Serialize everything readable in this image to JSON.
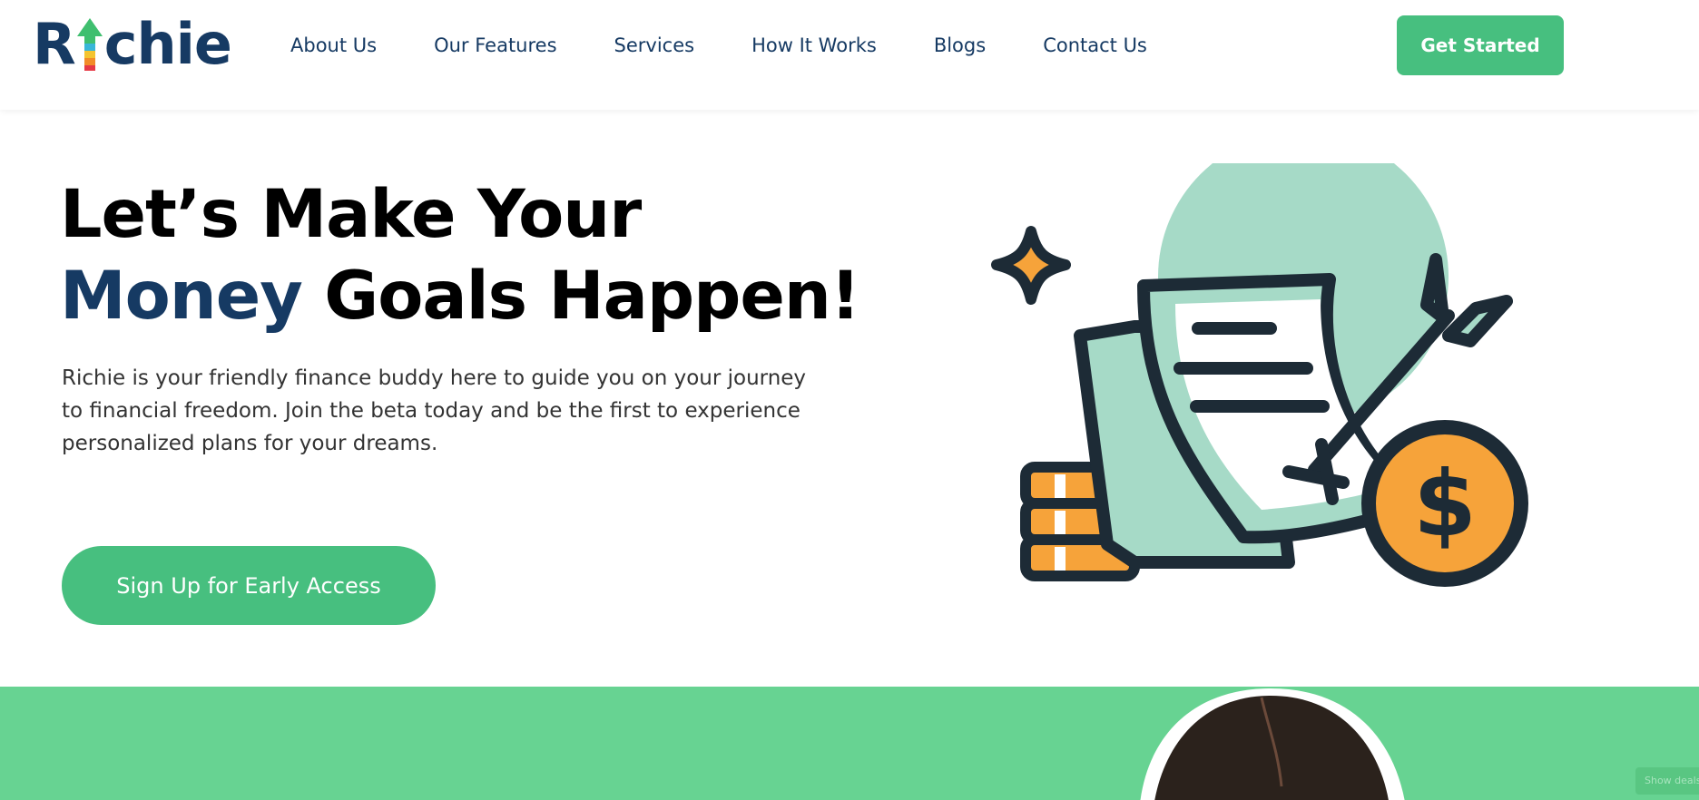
{
  "brand": {
    "logo_text_prefix": "R",
    "logo_text_suffix": "chie",
    "primary_color": "#163a63",
    "accent_color": "#47bf7f"
  },
  "nav": {
    "items": [
      "About Us",
      "Our Features",
      "Services",
      "How It Works",
      "Blogs",
      "Contact Us"
    ],
    "cta_label": "Get Started"
  },
  "hero": {
    "title_line1": "Let’s Make Your",
    "title_accent": "Money",
    "title_line2_rest": "Goals Happen!",
    "description": "Richie is your friendly finance buddy here to guide you on your journey to financial freedom. Join the beta today and be the first to experience personalized plans for your dreams.",
    "signup_label": "Sign Up for Early Access"
  },
  "footer_badge": {
    "label": "Show deals"
  },
  "icons": {
    "illustration": "finance-goal-illustration-icon",
    "logo_arrow": "growth-arrow-icon"
  }
}
